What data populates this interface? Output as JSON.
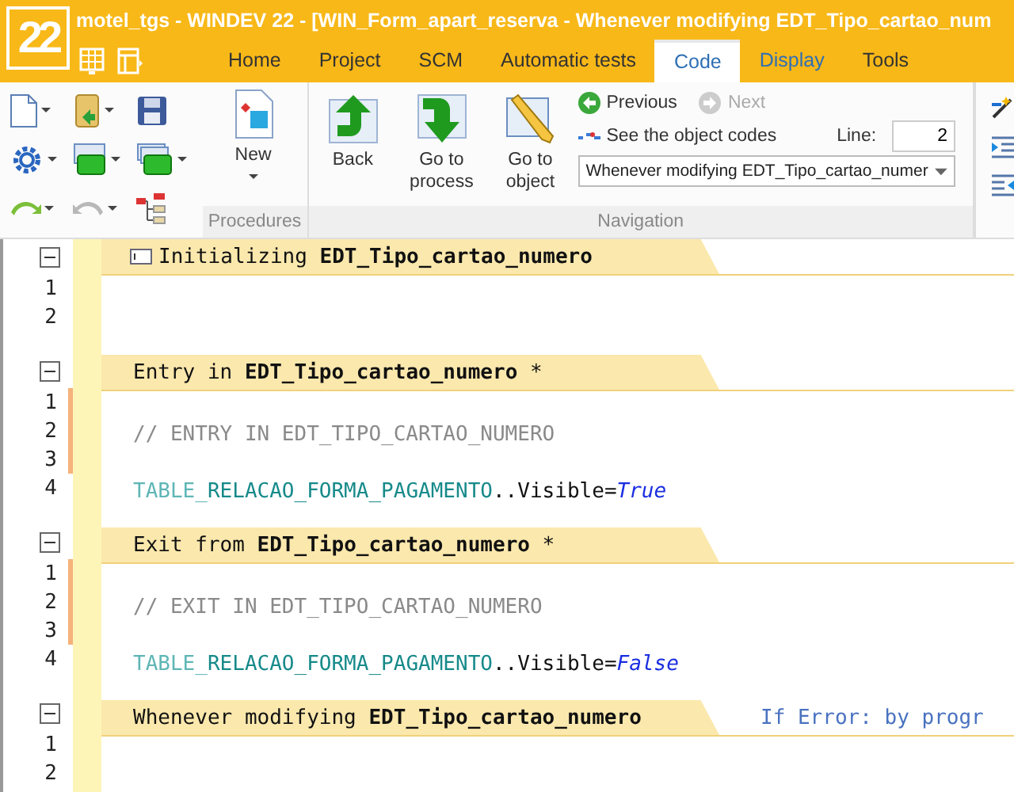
{
  "window": {
    "logo": "22",
    "title": "motel_tgs - WINDEV 22 - [WIN_Form_apart_reserva - Whenever modifying EDT_Tipo_cartao_num"
  },
  "tabs": [
    {
      "label": "Home",
      "selected": false,
      "kind": "normal"
    },
    {
      "label": "Project",
      "selected": false,
      "kind": "normal"
    },
    {
      "label": "SCM",
      "selected": false,
      "kind": "normal"
    },
    {
      "label": "Automatic tests",
      "selected": false,
      "kind": "normal"
    },
    {
      "label": "Code",
      "selected": true,
      "kind": "normal"
    },
    {
      "label": "Display",
      "selected": false,
      "kind": "contextual"
    },
    {
      "label": "Tools",
      "selected": false,
      "kind": "normal"
    }
  ],
  "ribbon": {
    "procedures": {
      "new_label": "New",
      "group_label": "Procedures"
    },
    "navigation": {
      "buttons": [
        {
          "kind": "back",
          "label": "Back"
        },
        {
          "kind": "process",
          "label": "Go to process"
        },
        {
          "kind": "object",
          "label": "Go to object"
        }
      ],
      "previous": {
        "label": "Previous",
        "disabled": false
      },
      "next": {
        "label": "Next",
        "disabled": true
      },
      "object_codes": "See the object codes",
      "line_label": "Line:",
      "line_value": "2",
      "event_dropdown": "Whenever modifying EDT_Tipo_cartao_numer",
      "group_label": "Navigation"
    }
  },
  "sections": [
    {
      "header": "Initializing **EDT_Tipo_cartao_numero**",
      "has_icon": true,
      "lines": [
        {
          "number": "1",
          "modified": false
        },
        {
          "number": "2",
          "modified": false
        }
      ]
    },
    {
      "header": "Entry in **EDT_Tipo_cartao_numero** *",
      "has_icon": false,
      "lines": [
        {
          "number": "1",
          "modified": true
        },
        {
          "number": "2",
          "modified": true,
          "tokens": [
            {
              "kind": "comment",
              "text": "// ENTRY IN EDT_TIPO_CARTAO_NUMERO"
            }
          ]
        },
        {
          "number": "3",
          "modified": true
        },
        {
          "number": "4",
          "modified": false,
          "tokens": [
            {
              "kind": "prefix",
              "text": "TABLE_"
            },
            {
              "kind": "control",
              "text": "RELACAO_FORMA_PAGAMENTO"
            },
            {
              "kind": "plain",
              "text": "..Visible"
            },
            {
              "kind": "operator",
              "text": "="
            },
            {
              "kind": "constant",
              "text": "True"
            }
          ]
        }
      ]
    },
    {
      "header": "Exit from **EDT_Tipo_cartao_numero** *",
      "has_icon": false,
      "lines": [
        {
          "number": "1",
          "modified": true
        },
        {
          "number": "2",
          "modified": true,
          "tokens": [
            {
              "kind": "comment",
              "text": "// EXIT IN EDT_TIPO_CARTAO_NUMERO"
            }
          ]
        },
        {
          "number": "3",
          "modified": true
        },
        {
          "number": "4",
          "modified": false,
          "tokens": [
            {
              "kind": "prefix",
              "text": "TABLE_"
            },
            {
              "kind": "control",
              "text": "RELACAO_FORMA_PAGAMENTO"
            },
            {
              "kind": "plain",
              "text": "..Visible"
            },
            {
              "kind": "operator",
              "text": "="
            },
            {
              "kind": "constant",
              "text": "False"
            }
          ]
        }
      ]
    },
    {
      "header": "Whenever modifying **EDT_Tipo_cartao_numero**",
      "has_icon": false,
      "note": "If Error: by progr",
      "lines": [
        {
          "number": "1",
          "modified": false
        },
        {
          "number": "2",
          "modified": false
        }
      ]
    }
  ]
}
